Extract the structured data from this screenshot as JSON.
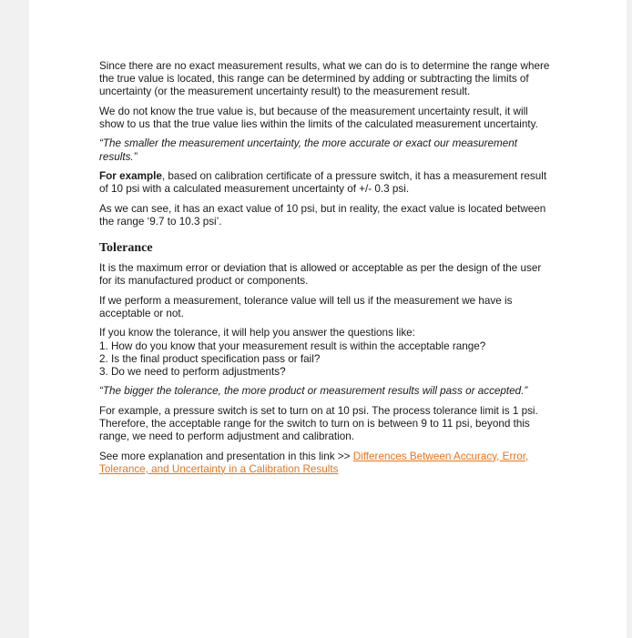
{
  "paragraphs_intro": [
    "Since there are no exact measurement results, what we can do is to determine the range where the true value is located, this range can be determined by adding or subtracting the limits of uncertainty (or the measurement uncertainty result) to the measurement result.",
    "We do not know the true value is, but because of the measurement uncertainty result, it will show to us that the true value lies within the limits of the calculated measurement uncertainty.",
    "“The smaller the measurement uncertainty, the more accurate or exact our measurement results.”"
  ],
  "example": {
    "lead": "For example",
    "text": ", based on calibration certificate of a pressure switch, it has a measurement result of 10 psi with a calculated measurement uncertainty of +/- 0.3 psi."
  },
  "paragraph_range": "As we can see, it has an exact value of 10 psi, but in reality, the exact value is located between the range  ‘9.7 to 10.3 psi’.",
  "tolerance_heading": "Tolerance",
  "tolerance_paragraphs": [
    "It is the maximum error or deviation that is allowed or acceptable as per the design of the user for its manufactured product or components.",
    "If we perform a measurement, tolerance value will tell us if the measurement we have is acceptable or not."
  ],
  "questions": {
    "intro": "If you know the tolerance, it will help you answer the questions like:",
    "items": [
      "1. How do you know that your measurement result is within the acceptable range?",
      "2. Is the final product specification pass or fail?",
      "3. Do we need to perform adjustments?"
    ]
  },
  "quote_tolerance": "“The bigger the tolerance, the more product or measurement results will pass or accepted.”",
  "paragraph_example2": "For example, a pressure switch is set to turn on at 10 psi. The process tolerance limit is 1 psi. Therefore, the acceptable range for the switch to turn on is between 9 to 11 psi, beyond this range, we need to perform adjustment and calibration.",
  "see_more": {
    "prefix": "See more explanation and presentation in this link >> ",
    "link_text": "Differences Between Accuracy, Error, Tolerance, and Uncertainty in a Calibration Results"
  },
  "colors": {
    "link": "#e8751a",
    "text": "#1a1a1a"
  }
}
